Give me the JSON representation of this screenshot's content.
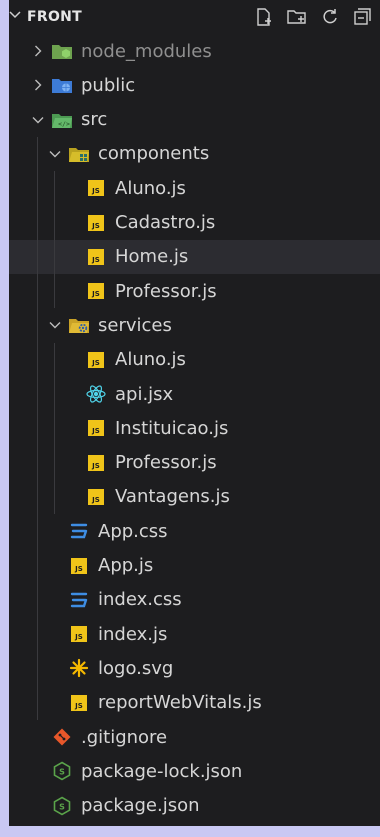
{
  "explorer": {
    "title": "FRONT",
    "actions": [
      "new-file-icon",
      "new-folder-icon",
      "refresh-icon",
      "collapse-icon"
    ],
    "tree": [
      {
        "label": "node_modules",
        "kind": "folder",
        "state": "collapsed",
        "icon": "folder-node-icon",
        "dim": true
      },
      {
        "label": "public",
        "kind": "folder",
        "state": "collapsed",
        "icon": "folder-public-icon"
      },
      {
        "label": "src",
        "kind": "folder",
        "state": "expanded",
        "icon": "folder-src-icon"
      },
      {
        "label": "components",
        "kind": "folder",
        "state": "expanded",
        "icon": "folder-components-icon"
      },
      {
        "label": "Aluno.js",
        "kind": "file",
        "icon": "js-file-icon"
      },
      {
        "label": "Cadastro.js",
        "kind": "file",
        "icon": "js-file-icon"
      },
      {
        "label": "Home.js",
        "kind": "file",
        "icon": "js-file-icon",
        "selected": true
      },
      {
        "label": "Professor.js",
        "kind": "file",
        "icon": "js-file-icon"
      },
      {
        "label": "services",
        "kind": "folder",
        "state": "expanded",
        "icon": "folder-services-icon"
      },
      {
        "label": "Aluno.js",
        "kind": "file",
        "icon": "js-file-icon"
      },
      {
        "label": "api.jsx",
        "kind": "file",
        "icon": "react-icon"
      },
      {
        "label": "Instituicao.js",
        "kind": "file",
        "icon": "js-file-icon"
      },
      {
        "label": "Professor.js",
        "kind": "file",
        "icon": "js-file-icon"
      },
      {
        "label": "Vantagens.js",
        "kind": "file",
        "icon": "js-file-icon"
      },
      {
        "label": "App.css",
        "kind": "file",
        "icon": "css-file-icon"
      },
      {
        "label": "App.js",
        "kind": "file",
        "icon": "js-file-icon"
      },
      {
        "label": "index.css",
        "kind": "file",
        "icon": "css-file-icon"
      },
      {
        "label": "index.js",
        "kind": "file",
        "icon": "js-file-icon"
      },
      {
        "label": "logo.svg",
        "kind": "file",
        "icon": "svg-file-icon"
      },
      {
        "label": "reportWebVitals.js",
        "kind": "file",
        "icon": "js-file-icon"
      },
      {
        "label": ".gitignore",
        "kind": "file",
        "icon": "git-icon"
      },
      {
        "label": "package-lock.json",
        "kind": "file",
        "icon": "nodejs-icon"
      },
      {
        "label": "package.json",
        "kind": "file",
        "icon": "nodejs-icon"
      }
    ]
  },
  "colors": {
    "background": "#1d1d1f",
    "frame": "#c9c8f3",
    "text": "#d6d6d6",
    "selected_row": "#2c2c31",
    "js_yellow": "#f0c419",
    "css_blue": "#3e8de3",
    "react_cyan": "#4fd2e8",
    "git_orange": "#e8572a",
    "node_green": "#5aa34a"
  }
}
